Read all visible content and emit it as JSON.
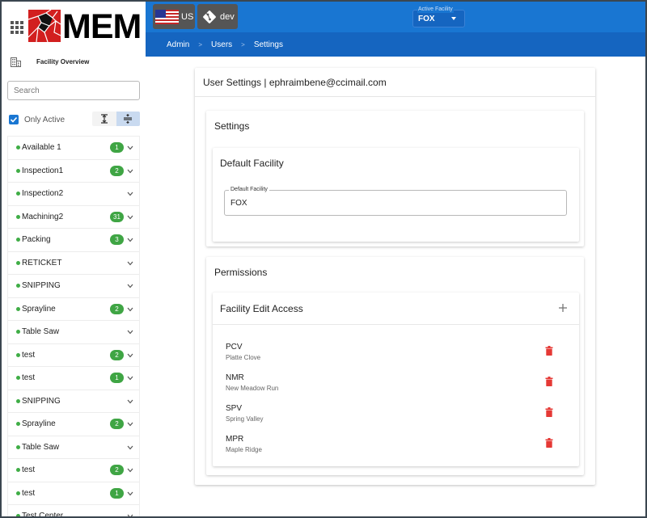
{
  "brand": {
    "logo_text": "MEM",
    "facility_overview_label": "Facility Overview"
  },
  "sidebar": {
    "search_placeholder": "Search",
    "only_active_label": "Only Active",
    "only_active_checked": true,
    "status_color": "#3fad46",
    "lines": [
      {
        "name": "Available 1",
        "count": "1"
      },
      {
        "name": "Inspection1",
        "count": "2"
      },
      {
        "name": "Inspection2",
        "count": null
      },
      {
        "name": "Machining2",
        "count": "31"
      },
      {
        "name": "Packing",
        "count": "3"
      },
      {
        "name": "RETICKET",
        "count": null
      },
      {
        "name": "SNIPPING",
        "count": null
      },
      {
        "name": "Sprayline",
        "count": "2"
      },
      {
        "name": "Table Saw",
        "count": null
      },
      {
        "name": "test",
        "count": "2"
      },
      {
        "name": "test",
        "count": "1"
      },
      {
        "name": "SNIPPING",
        "count": null
      },
      {
        "name": "Sprayline",
        "count": "2"
      },
      {
        "name": "Table Saw",
        "count": null
      },
      {
        "name": "test",
        "count": "2"
      },
      {
        "name": "test",
        "count": "1"
      },
      {
        "name": "Test Center",
        "count": null
      }
    ]
  },
  "header": {
    "region_label": "US",
    "branch_label": "dev",
    "active_facility_label": "Active Facility",
    "active_facility_value": "FOX",
    "accent_color": "#1976d2"
  },
  "breadcrumb": [
    "Admin",
    "Users",
    "Settings"
  ],
  "breadcrumb_separator": ">",
  "main": {
    "title": "User Settings | ephraimbene@ccimail.com",
    "settings_title": "Settings",
    "default_facility": {
      "title": "Default Facility",
      "field_label": "Default Facility",
      "field_value": "FOX"
    },
    "permissions_title": "Permissions",
    "facility_edit_access": {
      "title": "Facility Edit Access",
      "items": [
        {
          "code": "PCV",
          "name": "Platte Clove"
        },
        {
          "code": "NMR",
          "name": "New Meadow Run"
        },
        {
          "code": "SPV",
          "name": "Spring Valley"
        },
        {
          "code": "MPR",
          "name": "Maple Ridge"
        }
      ],
      "delete_color": "#e53935"
    }
  }
}
